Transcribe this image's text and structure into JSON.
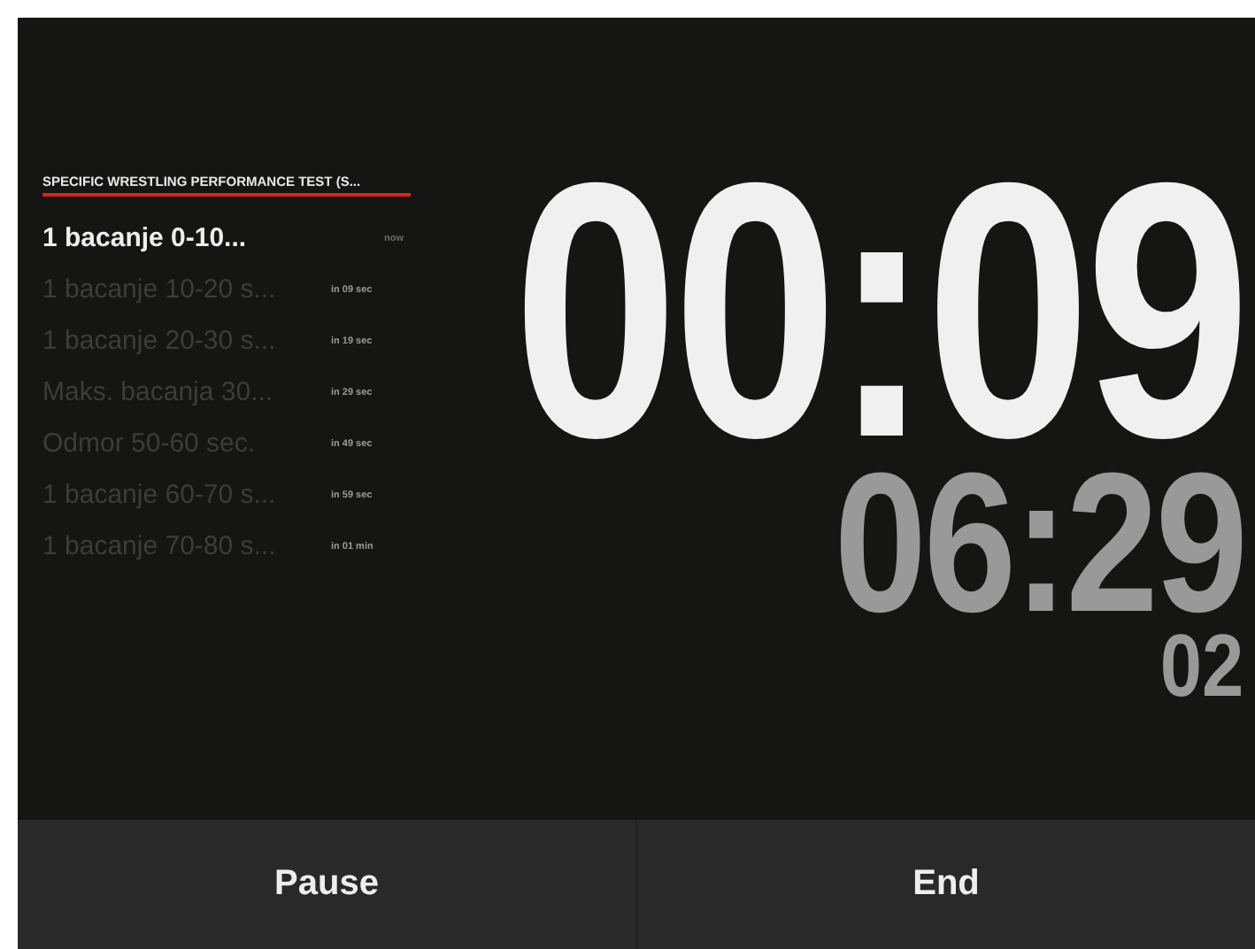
{
  "workout": {
    "title": "SPECIFIC WRESTLING PERFORMANCE TEST (S..."
  },
  "intervals": [
    {
      "name": "1 bacanje 0-10...",
      "time": "now",
      "current": true
    },
    {
      "name": "1 bacanje 10-20 s...",
      "time": "in 09 sec",
      "current": false
    },
    {
      "name": "1 bacanje 20-30 s...",
      "time": "in 19 sec",
      "current": false
    },
    {
      "name": "Maks. bacanja 30...",
      "time": "in 29 sec",
      "current": false
    },
    {
      "name": "Odmor 50-60 sec.",
      "time": "in 49 sec",
      "current": false
    },
    {
      "name": "1 bacanje 60-70 s...",
      "time": "in 59 sec",
      "current": false
    },
    {
      "name": "1 bacanje 70-80 s...",
      "time": "in 01 min",
      "current": false
    }
  ],
  "timer": {
    "interval_time": "00:09",
    "total_time": "06:29",
    "round": "02"
  },
  "buttons": [
    {
      "label": "Pause"
    },
    {
      "label": "End"
    }
  ]
}
